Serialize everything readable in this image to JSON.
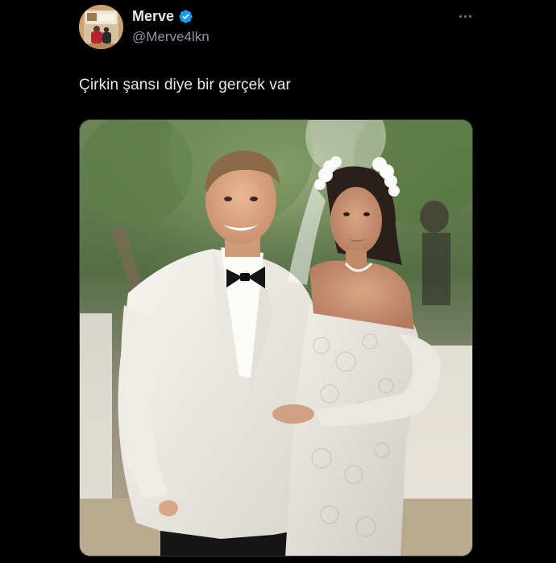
{
  "tweet": {
    "author": {
      "display_name": "Merve",
      "handle": "@Merve4lkn",
      "verified": true,
      "avatar_icon": "profile-photo-avatar"
    },
    "text": "Çirkin şansı diye bir gerçek var",
    "more_icon": "more-dots-icon",
    "media": {
      "type": "photo",
      "alt_description_icon": "wedding-photo"
    }
  },
  "colors": {
    "background": "#000000",
    "text_primary": "#e7e9ea",
    "text_secondary": "#8b98a5",
    "verified_blue": "#1d9bf0"
  }
}
